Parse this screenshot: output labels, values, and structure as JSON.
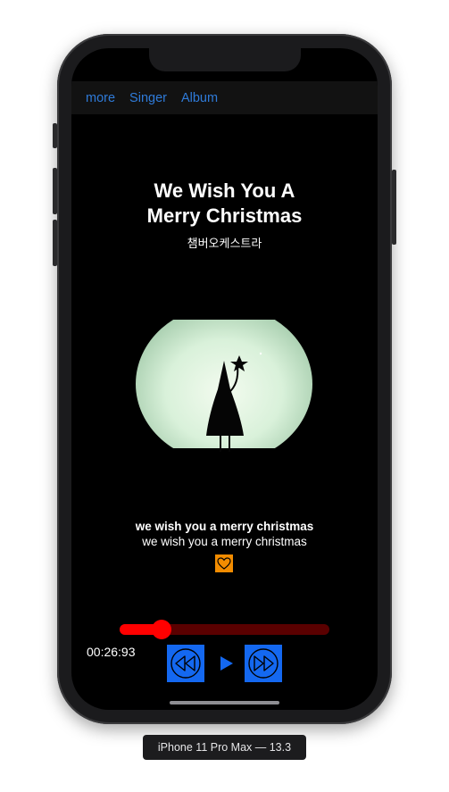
{
  "device_caption": "iPhone 11 Pro Max — 13.3",
  "navbar": {
    "links": [
      "more",
      "Singer",
      "Album"
    ]
  },
  "song": {
    "title_line1": "We Wish You A",
    "title_line2": "Merry Christmas",
    "artist": "챔버오케스트라"
  },
  "lyrics": {
    "current": "we wish you a merry christmas",
    "next": "we wish you a merry christmas"
  },
  "player": {
    "elapsed": "00:26:93",
    "progress_fraction": 0.2,
    "icons": [
      "heart-icon",
      "rewind-icon",
      "play-icon",
      "fast-forward-icon"
    ]
  },
  "colors": {
    "accent": "#2f7bd9",
    "slider_fill": "#ff0000",
    "slider_track": "#5a0000",
    "control_button": "#1468f0",
    "like_button": "#f28c00"
  }
}
